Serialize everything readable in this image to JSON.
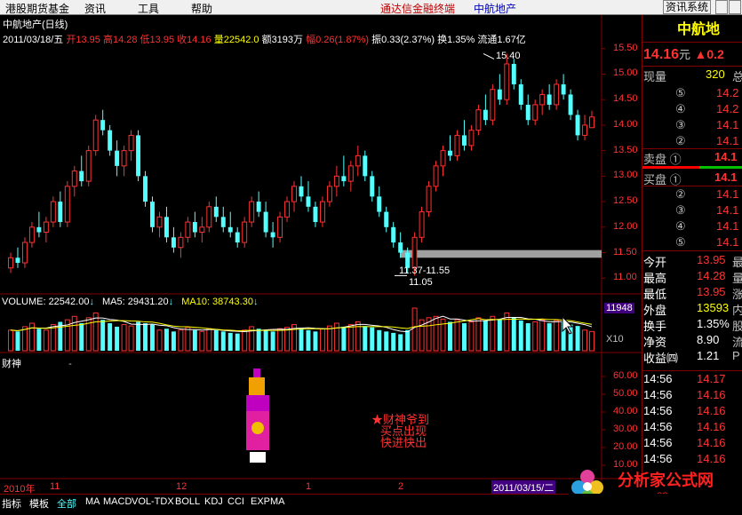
{
  "menu": {
    "items": [
      "港股期货基金",
      "资讯",
      "工具",
      "帮助"
    ],
    "app_title": "通达信金融终端",
    "stock_title": "中航地产",
    "right_button": "资讯系统"
  },
  "header": {
    "name": "中航地产(日线)",
    "date": "2011/03/18/五",
    "open_label": "开",
    "open": "13.95",
    "high_label": "高",
    "high": "14.28",
    "low_label": "低",
    "low": "13.95",
    "close_label": "收",
    "close": "14.16",
    "vol_label": "量",
    "vol": "22542.0",
    "amt_label": "额",
    "amt": "3193万",
    "chg_label": "幅",
    "chg": "0.26(1.87%)",
    "amp_label": "振",
    "amp": "0.33(2.37%)",
    "turn_label": "换",
    "turn": "1.35%",
    "float_label": "流通",
    "float": "1.67亿"
  },
  "price_axis": [
    "15.50",
    "15.00",
    "14.50",
    "14.00",
    "13.50",
    "13.00",
    "12.50",
    "12.00",
    "11.50",
    "11.00"
  ],
  "annotations": {
    "high_label": "15.40",
    "low_range": "11.37-11.55",
    "low_label": "11.05"
  },
  "volume": {
    "label": "VOLUME: 22542.00",
    "ma5": "MA5: 29431.20",
    "ma10": "MA10: 38743.30",
    "axis_value": "11948",
    "axis_unit": "X10"
  },
  "indicator": {
    "name": "财神",
    "dash": "-",
    "axis": [
      "60.00",
      "50.00",
      "40.00",
      "30.00",
      "20.00",
      "10.00"
    ],
    "note_line1": "★财神爷到",
    "note_line2": "买点出现",
    "note_line3": "快进快出"
  },
  "timeline": {
    "year": "2010年",
    "m11": "11",
    "m12": "12",
    "m1": "1",
    "m2": "2",
    "current": "2011/03/15/二"
  },
  "tabs": [
    "指标",
    "模板",
    "全部",
    "MA",
    "MACD",
    "VOL-TDX",
    "BOLL",
    "KDJ",
    "CCI",
    "EXPMA"
  ],
  "quote": {
    "name": "中航地",
    "price": "14.16",
    "unit": "元",
    "change": "▲0.2",
    "cur_vol_label": "现量",
    "cur_vol": "320",
    "cur_vol_tail": "总",
    "sell": [
      {
        "lvl": "⑤",
        "price": "14.2"
      },
      {
        "lvl": "④",
        "price": "14.2"
      },
      {
        "lvl": "③",
        "price": "14.1"
      },
      {
        "lvl": "②",
        "price": "14.1"
      }
    ],
    "sell1_label": "卖盘 ①",
    "sell1_price": "14.1",
    "buy1_label": "买盘 ①",
    "buy1_price": "14.1",
    "buy": [
      {
        "lvl": "②",
        "price": "14.1"
      },
      {
        "lvl": "③",
        "price": "14.1"
      },
      {
        "lvl": "④",
        "price": "14.1"
      },
      {
        "lvl": "⑤",
        "price": "14.1"
      }
    ],
    "stats": [
      {
        "label": "今开",
        "value": "13.95",
        "tail": "最"
      },
      {
        "label": "最高",
        "value": "14.28",
        "tail": "量"
      },
      {
        "label": "最低",
        "value": "13.95",
        "tail": "涨"
      },
      {
        "label": "外盘",
        "value": "13593",
        "tail": "内"
      },
      {
        "label": "换手",
        "value": "1.35%",
        "tail": "股"
      },
      {
        "label": "净资",
        "value": "8.90",
        "tail": "流"
      },
      {
        "label": "收益㈣",
        "value": "1.21",
        "tail": "P"
      }
    ],
    "ticks": [
      {
        "time": "14:56",
        "price": "14.17"
      },
      {
        "time": "14:56",
        "price": "14.16"
      },
      {
        "time": "14:56",
        "price": "14.16"
      },
      {
        "time": "14:56",
        "price": "14.16"
      },
      {
        "time": "14:56",
        "price": "14.16"
      },
      {
        "time": "14:56",
        "price": "14.16"
      }
    ]
  },
  "watermark": {
    "title": "分析家公式网",
    "url": "www.88gs.com"
  },
  "colors": {
    "up": "#ff3232",
    "down": "#54ffff",
    "frame": "#800000"
  },
  "chart_data": {
    "type": "candlestick",
    "ylim": [
      10.9,
      15.6
    ],
    "candles": [
      [
        11.2,
        11.5,
        11.1,
        11.4
      ],
      [
        11.4,
        11.6,
        11.2,
        11.3
      ],
      [
        11.3,
        11.8,
        11.2,
        11.7
      ],
      [
        11.7,
        12.1,
        11.6,
        12.0
      ],
      [
        12.0,
        12.3,
        11.8,
        11.9
      ],
      [
        11.9,
        12.2,
        11.7,
        12.1
      ],
      [
        12.1,
        12.6,
        12.0,
        12.5
      ],
      [
        12.5,
        12.7,
        12.0,
        12.1
      ],
      [
        12.1,
        12.9,
        12.0,
        12.8
      ],
      [
        12.8,
        13.2,
        12.6,
        13.1
      ],
      [
        13.1,
        13.4,
        12.8,
        12.9
      ],
      [
        12.9,
        13.6,
        12.8,
        13.5
      ],
      [
        13.5,
        14.2,
        13.4,
        14.1
      ],
      [
        14.1,
        14.3,
        13.8,
        13.9
      ],
      [
        13.9,
        14.0,
        13.4,
        13.5
      ],
      [
        13.5,
        13.7,
        13.0,
        13.2
      ],
      [
        13.2,
        13.6,
        13.0,
        13.5
      ],
      [
        13.5,
        13.9,
        13.3,
        13.8
      ],
      [
        13.8,
        13.9,
        12.9,
        13.0
      ],
      [
        13.0,
        13.1,
        12.4,
        12.5
      ],
      [
        12.5,
        12.6,
        11.9,
        12.0
      ],
      [
        12.0,
        12.3,
        11.8,
        12.2
      ],
      [
        12.2,
        12.4,
        11.7,
        11.8
      ],
      [
        11.8,
        12.0,
        11.5,
        11.6
      ],
      [
        11.6,
        11.9,
        11.4,
        11.8
      ],
      [
        11.8,
        12.2,
        11.7,
        12.1
      ],
      [
        12.1,
        12.3,
        11.8,
        11.9
      ],
      [
        11.9,
        12.2,
        11.7,
        12.0
      ],
      [
        12.0,
        12.5,
        11.9,
        12.4
      ],
      [
        12.4,
        12.6,
        12.1,
        12.2
      ],
      [
        12.2,
        12.4,
        11.9,
        12.0
      ],
      [
        12.0,
        12.3,
        11.8,
        11.9
      ],
      [
        11.9,
        12.0,
        11.6,
        11.7
      ],
      [
        11.7,
        12.2,
        11.6,
        12.1
      ],
      [
        12.1,
        12.6,
        12.0,
        12.5
      ],
      [
        12.5,
        12.7,
        12.2,
        12.3
      ],
      [
        12.3,
        12.5,
        11.8,
        11.9
      ],
      [
        11.9,
        12.1,
        11.6,
        11.8
      ],
      [
        11.8,
        12.3,
        11.7,
        12.2
      ],
      [
        12.2,
        12.6,
        12.1,
        12.5
      ],
      [
        12.5,
        12.9,
        12.3,
        12.8
      ],
      [
        12.8,
        13.0,
        12.5,
        12.6
      ],
      [
        12.6,
        12.9,
        12.3,
        12.4
      ],
      [
        12.4,
        12.5,
        12.0,
        12.1
      ],
      [
        12.1,
        12.6,
        12.0,
        12.5
      ],
      [
        12.5,
        12.9,
        12.4,
        12.8
      ],
      [
        12.8,
        13.2,
        12.6,
        13.0
      ],
      [
        13.0,
        13.4,
        12.8,
        12.9
      ],
      [
        12.9,
        13.3,
        12.7,
        13.2
      ],
      [
        13.2,
        13.6,
        13.0,
        13.4
      ],
      [
        13.4,
        13.5,
        12.9,
        13.0
      ],
      [
        13.0,
        13.1,
        12.5,
        12.6
      ],
      [
        12.6,
        12.8,
        12.2,
        12.3
      ],
      [
        12.3,
        12.4,
        11.9,
        12.0
      ],
      [
        12.0,
        12.1,
        11.6,
        11.7
      ],
      [
        11.7,
        11.9,
        11.4,
        11.5
      ],
      [
        11.5,
        11.6,
        11.1,
        11.2
      ],
      [
        11.2,
        11.9,
        11.05,
        11.8
      ],
      [
        11.8,
        12.4,
        11.7,
        12.3
      ],
      [
        12.3,
        12.9,
        12.2,
        12.8
      ],
      [
        12.8,
        13.3,
        12.7,
        13.2
      ],
      [
        13.2,
        13.6,
        13.0,
        13.5
      ],
      [
        13.5,
        13.8,
        13.3,
        13.4
      ],
      [
        13.4,
        13.9,
        13.3,
        13.8
      ],
      [
        13.8,
        14.1,
        13.5,
        13.6
      ],
      [
        13.6,
        14.0,
        13.5,
        13.9
      ],
      [
        13.9,
        14.4,
        13.8,
        14.3
      ],
      [
        14.3,
        14.6,
        14.0,
        14.1
      ],
      [
        14.1,
        14.8,
        14.0,
        14.7
      ],
      [
        14.7,
        15.0,
        14.4,
        14.5
      ],
      [
        14.5,
        15.4,
        14.4,
        15.2
      ],
      [
        15.2,
        15.3,
        14.7,
        14.8
      ],
      [
        14.8,
        14.9,
        14.3,
        14.4
      ],
      [
        14.4,
        14.6,
        14.0,
        14.1
      ],
      [
        14.1,
        14.5,
        14.0,
        14.4
      ],
      [
        14.4,
        14.7,
        14.2,
        14.6
      ],
      [
        14.6,
        14.8,
        14.3,
        14.4
      ],
      [
        14.4,
        14.9,
        14.3,
        14.8
      ],
      [
        14.8,
        15.0,
        14.5,
        14.6
      ],
      [
        14.6,
        14.7,
        14.1,
        14.2
      ],
      [
        14.2,
        14.3,
        13.7,
        13.8
      ],
      [
        13.8,
        14.2,
        13.7,
        14.0
      ],
      [
        13.95,
        14.28,
        13.95,
        14.16
      ]
    ],
    "volumes": [
      30,
      28,
      35,
      40,
      32,
      30,
      38,
      42,
      45,
      50,
      40,
      48,
      55,
      45,
      40,
      35,
      38,
      36,
      42,
      40,
      38,
      30,
      32,
      28,
      30,
      34,
      30,
      28,
      32,
      30,
      28,
      26,
      25,
      30,
      35,
      32,
      30,
      28,
      32,
      34,
      38,
      33,
      30,
      28,
      32,
      36,
      40,
      35,
      38,
      42,
      36,
      34,
      30,
      28,
      26,
      24,
      30,
      62,
      45,
      48,
      50,
      46,
      42,
      45,
      40,
      42,
      48,
      44,
      50,
      45,
      55,
      48,
      44,
      40,
      42,
      45,
      40,
      44,
      42,
      38,
      36,
      30,
      28
    ]
  }
}
